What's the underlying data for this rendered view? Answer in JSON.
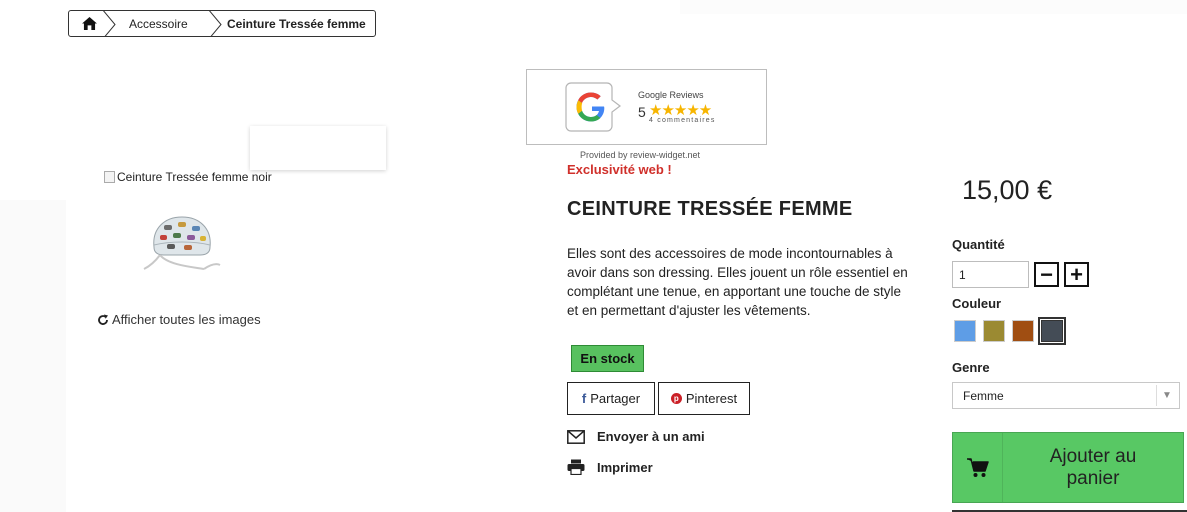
{
  "breadcrumb": {
    "home_icon": "home-icon",
    "items": [
      "Accessoire",
      "Ceinture Tressée femme"
    ]
  },
  "reviews": {
    "title": "Google Reviews",
    "score": "5",
    "count_text": "4 commentaires",
    "stars": "★★★★★",
    "rating": 5,
    "provided_by": "Provided by review-widget.net"
  },
  "gallery": {
    "main_image_alt": "Ceinture Tressée femme noir",
    "show_all_label": "Afficher toutes les images"
  },
  "product": {
    "badge": "Exclusivité web !",
    "title": "CEINTURE TRESSÉE FEMME",
    "description": "Elles sont des accessoires de mode incontournables à avoir dans son dressing. Elles jouent un rôle essentiel en complétant une tenue, en apportant une touche de style et en permettant d'ajuster les vêtements.",
    "stock_label": "En stock"
  },
  "share": {
    "facebook_label": "Partager",
    "pinterest_label": "Pinterest",
    "email_label": "Envoyer à un ami",
    "print_label": "Imprimer"
  },
  "purchase": {
    "price": "15,00 €",
    "quantity_label": "Quantité",
    "quantity_value": "1",
    "minus_label": "−",
    "plus_label": "+",
    "color_label": "Couleur",
    "colors": [
      "#5e9de6",
      "#9b8a32",
      "#a04e12",
      "#444c56"
    ],
    "selected_color_index": 3,
    "genre_label": "Genre",
    "genre_value": "Femme",
    "add_to_cart_label": "Ajouter au panier"
  },
  "colors": {
    "accent_green": "#58c864",
    "stock_green": "#58c15f",
    "badge_red": "#d0302b",
    "star_gold": "#f7b500"
  }
}
